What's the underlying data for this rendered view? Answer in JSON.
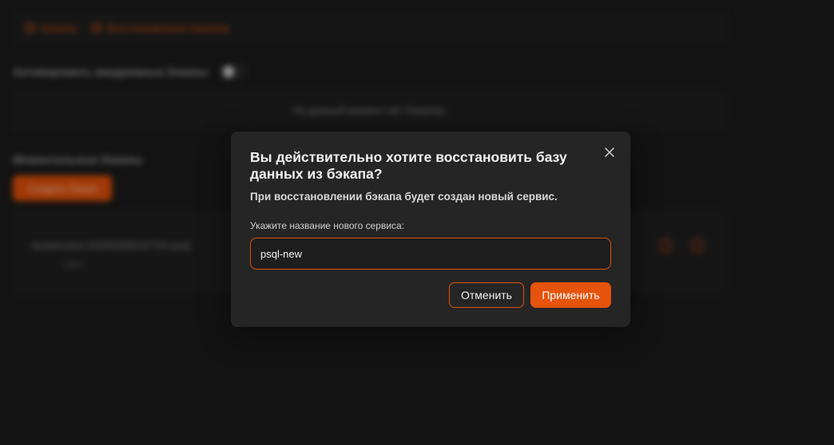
{
  "background": {
    "tabs": [
      {
        "label": "Бэкапы",
        "icon": "clock-icon"
      },
      {
        "label": "Восстановление бэкапов",
        "icon": "restore-icon"
      }
    ],
    "daily_label": "Активировать ежедневные бэкапы",
    "empty_text": "На данный момент нет бэкапов.",
    "snapshots_title": "Моментальные бэкапы",
    "create_button": "Создать бэкап",
    "snapshot_name": "testamvara-20250328152724-psql",
    "snapshot_meta": "new"
  },
  "modal": {
    "title": "Вы действительно хотите восстановить базу данных из бэкапа?",
    "subtitle": "При восстановлении бэкапа будет создан новый сервис.",
    "field_label": "Укажите название нового сервиса:",
    "field_value": "psql-new",
    "cancel_label": "Отменить",
    "apply_label": "Применить"
  },
  "colors": {
    "accent": "#e0500a",
    "background": "#1b1b1b",
    "modal_bg": "#252525"
  }
}
